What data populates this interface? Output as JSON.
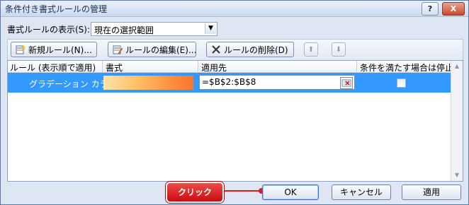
{
  "window": {
    "title": "条件付き書式ルールの管理",
    "help_label": "?",
    "close_label": "X"
  },
  "show_rules": {
    "label": "書式ルールの表示(S):",
    "value": "現在の選択範囲"
  },
  "toolbar": {
    "new_rule_label": "新規ルール(N)...",
    "edit_rule_label": "ルールの編集(E)...",
    "delete_rule_label": "ルールの削除(D)",
    "move_up_glyph": "⬆",
    "move_down_glyph": "⬇"
  },
  "grid": {
    "columns": [
      "ルール (表示順で適用)",
      "書式",
      "適用先",
      "条件を満たす場合は停止"
    ],
    "rows": [
      {
        "rule": "グラデーション カラ...",
        "applies_to": "=$B$2:$B$8",
        "stop_if_true": false
      }
    ]
  },
  "footer": {
    "ok_label": "OK",
    "cancel_label": "キャンセル",
    "apply_label": "適用"
  },
  "annotation": {
    "callout_label": "クリック"
  },
  "colors": {
    "selected_row": "#3399ff",
    "callout": "#d81e1e",
    "gradient_start": "#ffe3ad",
    "gradient_end": "#f6772e"
  }
}
